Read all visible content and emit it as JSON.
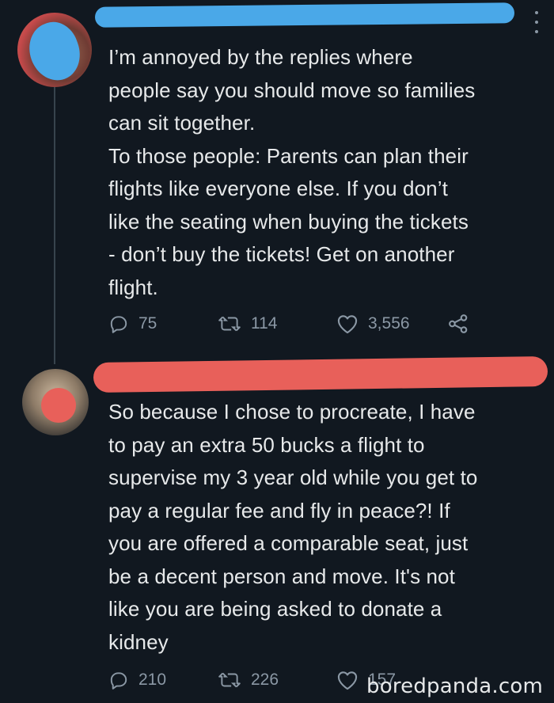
{
  "tweets": [
    {
      "text": "I’m annoyed by the replies where\npeople say you should move so families\ncan sit together.\nTo those people: Parents can plan their\nflights like everyone else. If you don’t\nlike the seating when buying the tickets\n- don’t buy the tickets! Get on another\nflight.",
      "replies": "75",
      "retweets": "114",
      "likes": "3,556"
    },
    {
      "text": "So because I chose to procreate, I have\nto pay an extra 50 bucks a flight to\nsupervise my 3 year old while you get to\npay a regular fee and fly in peace?! If\nyou are offered a comparable seat, just\nbe a decent person and move. It's not\nlike you are being asked to donate a\nkidney",
      "replies": "210",
      "retweets": "226",
      "likes": "157"
    }
  ],
  "watermark": "boredpanda.com",
  "colors": {
    "background": "#111820",
    "text": "#e7e9ea",
    "muted": "#8b98a5",
    "redact_blue": "#4aa8e8",
    "redact_red": "#e8605a"
  },
  "icons": [
    "reply-icon",
    "retweet-icon",
    "like-icon",
    "share-icon",
    "more-icon"
  ]
}
